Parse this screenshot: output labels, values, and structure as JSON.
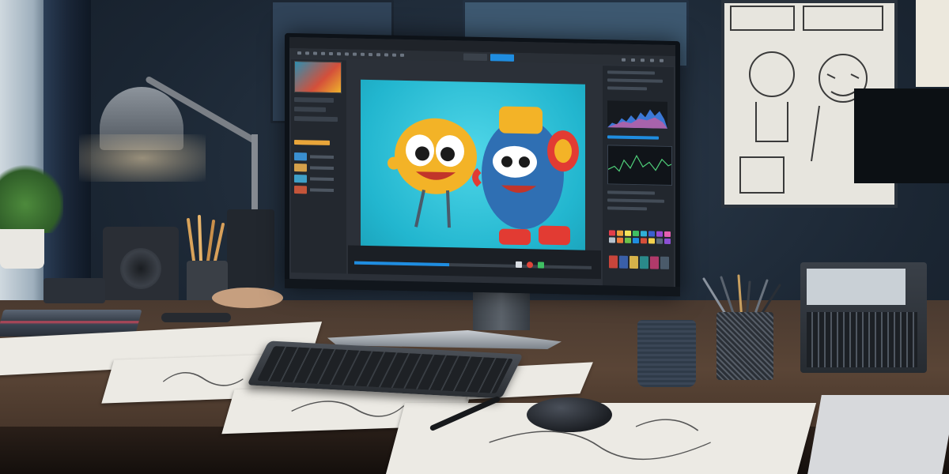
{
  "scene": {
    "description_colors": {
      "canvas_bg": "#2fc3d9",
      "accent_blue": "#1f8de0",
      "record_red": "#e0453a",
      "marker_green": "#3fbf62",
      "character_yellow": "#f3b327",
      "robot_blue": "#2f6fb3",
      "robot_red": "#e23b33"
    }
  },
  "editor": {
    "swatch_colors": [
      "#e33d4a",
      "#f0a43b",
      "#f6e45a",
      "#3fbf62",
      "#2fb0d6",
      "#3a5fd0",
      "#9a4ad4",
      "#e55fb0",
      "#b8c2cc",
      "#ee7a3b",
      "#6cc24a",
      "#1f8de0",
      "#d44f3a",
      "#f3d14d",
      "#5a6a7a",
      "#8c4fd4"
    ],
    "thumb_colors": [
      "#c8453b",
      "#3a5fa8",
      "#d6b24a",
      "#2a8a8a",
      "#b03a6a",
      "#4a5a6a"
    ]
  }
}
